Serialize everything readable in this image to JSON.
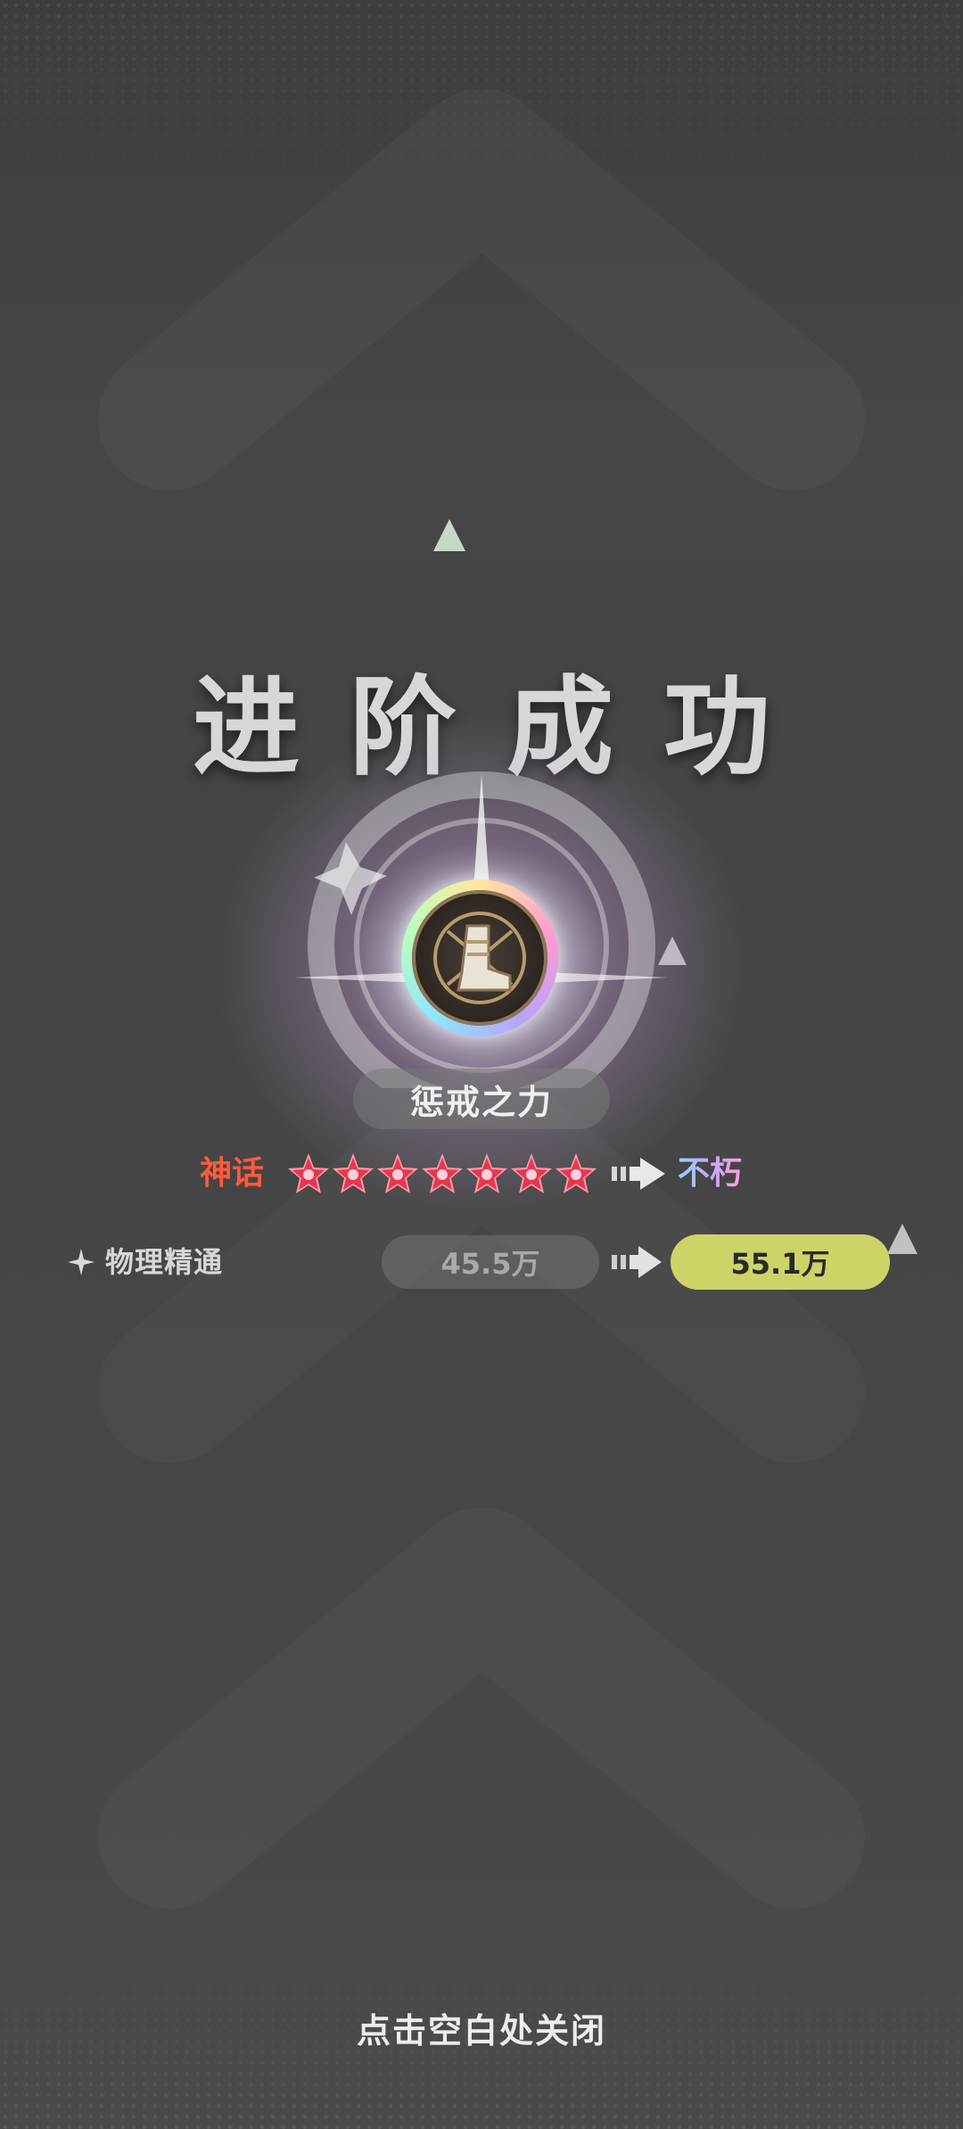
{
  "title": "进阶成功",
  "item": {
    "name": "惩戒之力",
    "icon": "boot-chains-icon"
  },
  "rarity": {
    "from": "神话",
    "to": "不朽",
    "stars": 7,
    "from_color": "#ff5a3c",
    "star_color": "#e8364e"
  },
  "stat": {
    "name": "物理精通",
    "old_value": "45.5万",
    "new_value": "55.1万",
    "highlight_color": "#ccd468"
  },
  "close_hint": "点击空白处关闭"
}
